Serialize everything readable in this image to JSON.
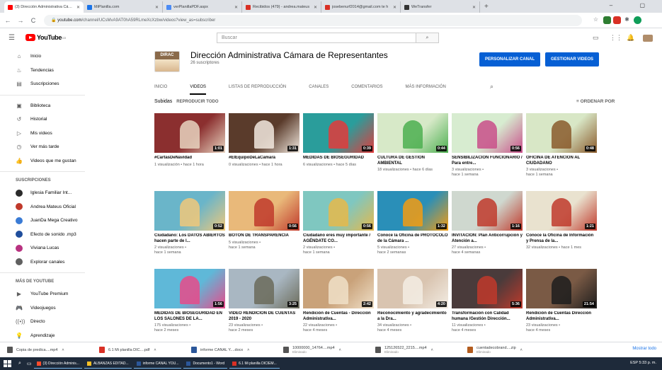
{
  "browser": {
    "tabs": [
      {
        "title": "(3) Dirección Administrativa Cám...",
        "color": "#ff0000",
        "active": true
      },
      {
        "title": "MiPlanilla.com",
        "color": "#1a73e8",
        "active": false
      },
      {
        "title": "verPlanillaPDF.aspx",
        "color": "#4b8bf5",
        "active": false
      },
      {
        "title": "Recibidos (479) - andrea.mateus",
        "color": "#d93025",
        "active": false
      },
      {
        "title": "josebenurf2014@gmail.com te h",
        "color": "#d93025",
        "active": false
      },
      {
        "title": "WeTransfer",
        "color": "#333333",
        "active": false
      }
    ],
    "url_domain": "youtube.com",
    "url_path": "/channel/UCsMvA9AT0hA59RLmeXcXzbw/videos?view_as=subscriber"
  },
  "masthead": {
    "logo_text": "YouTube",
    "logo_country": "CO",
    "search_placeholder": "Buscar"
  },
  "sidebar": {
    "main": [
      {
        "label": "Inicio",
        "icon": "home-icon",
        "glyph": "⌂"
      },
      {
        "label": "Tendencias",
        "icon": "trending-icon",
        "glyph": "♨"
      },
      {
        "label": "Suscripciones",
        "icon": "subscriptions-icon",
        "glyph": "▤"
      }
    ],
    "library": [
      {
        "label": "Biblioteca",
        "icon": "library-icon",
        "glyph": "▣"
      },
      {
        "label": "Historial",
        "icon": "history-icon",
        "glyph": "↺"
      },
      {
        "label": "Mis videos",
        "icon": "my-videos-icon",
        "glyph": "▷"
      },
      {
        "label": "Ver más tarde",
        "icon": "watch-later-icon",
        "glyph": "◷"
      },
      {
        "label": "Videos que me gustan",
        "icon": "liked-icon",
        "glyph": "👍"
      }
    ],
    "subs_heading": "SUSCRIPCIONES",
    "subs": [
      {
        "label": "Iglesia Familiar Int...",
        "color": "#2b2b2b"
      },
      {
        "label": "Andrea Mateus Oficial",
        "color": "#c0392b"
      },
      {
        "label": "JuanDa Mega Creativo",
        "color": "#3a7bd5"
      },
      {
        "label": "Efecto de sonido .mp3",
        "color": "#1f4e9c"
      },
      {
        "label": "Viviana Lucas",
        "color": "#b83280"
      },
      {
        "label": "Explorar canales",
        "color": "#606060"
      }
    ],
    "more_heading": "MÁS DE YOUTUBE",
    "more": [
      {
        "label": "YouTube Premium",
        "icon": "youtube-premium-icon",
        "glyph": "▶"
      },
      {
        "label": "Videojuegos",
        "icon": "gaming-icon",
        "glyph": "🎮"
      },
      {
        "label": "Directo",
        "icon": "live-icon",
        "glyph": "((•))"
      },
      {
        "label": "Aprendizaje",
        "icon": "learning-icon",
        "glyph": "💡"
      }
    ]
  },
  "channel": {
    "avatar_text": "DIRAC",
    "name": "Dirección Administrativa Cámara de Representantes",
    "subscribers": "26 suscriptores",
    "customize_label": "PERSONALIZAR CANAL",
    "manage_label": "GESTIONAR VIDEOS",
    "tabs": [
      "INICIO",
      "VIDEOS",
      "LISTAS DE REPRODUCCIÓN",
      "CANALES",
      "COMENTARIOS",
      "MÁS INFORMACIÓN"
    ],
    "active_tab": "VIDEOS",
    "shelf_title": "Subidas",
    "play_all": "REPRODUCIR TODO",
    "sort_label": "ORDENAR POR"
  },
  "videos": [
    {
      "title": "#CartasDeNavidad",
      "meta1": "1 visualización • hace 1 hora",
      "meta2": "",
      "dur": "1:01",
      "bg": "#8b2f2f",
      "fg": "#e8d4c0"
    },
    {
      "title": "#ElEquipoDeLaCamara",
      "meta1": "0 visualizaciones • hace 1 hora",
      "meta2": "",
      "dur": "1:31",
      "bg": "#5a3b2b",
      "fg": "#f2e9df"
    },
    {
      "title": "MEDIDAS DE BIOSEGURIDAD",
      "meta1": "6 visualizaciones • hace 5 días",
      "meta2": "",
      "dur": "0:39",
      "bg": "#2a9d9b",
      "fg": "#e23b3b"
    },
    {
      "title": "CULTURA DE GESTION AMBIENTAL",
      "meta1": "18 visualizaciones • hace 6 días",
      "meta2": "",
      "dur": "0:44",
      "bg": "#d7e9c8",
      "fg": "#4caf50"
    },
    {
      "title": "SENSIBILIZACIÓN FUNCIONARIO / Para entre...",
      "meta1": "3 visualizaciones •",
      "meta2": "hace 1 semana",
      "dur": "0:56",
      "bg": "#d7ecd0",
      "fg": "#c94f8a"
    },
    {
      "title": "OFICINA DE ATENCIÓN AL CIUDADANO",
      "meta1": "3 visualizaciones •",
      "meta2": "hace 1 semana",
      "dur": "0:48",
      "bg": "#d8e7c6",
      "fg": "#8a5a2b"
    },
    {
      "title": "Ciudadano: Los DATOS ABIERTOS hacen parte de l...",
      "meta1": "2 visualizaciones •",
      "meta2": "hace 1 semana",
      "dur": "0:52",
      "bg": "#6ab5c9",
      "fg": "#f0c87a"
    },
    {
      "title": "BOTON DE TRANSPARENCIA",
      "meta1": "5 visualizaciones •",
      "meta2": "hace 1 semana",
      "dur": "0:56",
      "bg": "#e9b97a",
      "fg": "#c0392b"
    },
    {
      "title": "Ciudadano eres muy importante / AGÉNDATE CO...",
      "meta1": "2 visualizaciones •",
      "meta2": "hace 1 semana",
      "dur": "0:56",
      "bg": "#7fc7c0",
      "fg": "#e6b84a"
    },
    {
      "title": "Conoce la Oficina de PROTOCOLO de la Cámara ...",
      "meta1": "5 visualizaciones •",
      "meta2": "hace 2 semanas",
      "dur": "1:32",
      "bg": "#2a8fb8",
      "fg": "#f39c12"
    },
    {
      "title": "INVITACIÓN: Plan Anticorrupción y Atención a...",
      "meta1": "27 visualizaciones •",
      "meta2": "hace 4 semanas",
      "dur": "1:16",
      "bg": "#cfd8cf",
      "fg": "#c0392b"
    },
    {
      "title": "Conoce la Oficina de Información y Prensa de la...",
      "meta1": "32 visualizaciones • hace 1 mes",
      "meta2": "",
      "dur": "1:21",
      "bg": "#e9e2cf",
      "fg": "#c0392b"
    },
    {
      "title": "MEDIDAS DE BIOSEGURIDAD EN LOS SALONES DE LA...",
      "meta1": "175 visualizaciones •",
      "meta2": "hace 2 meses",
      "dur": "1:56",
      "bg": "#5fb8d8",
      "fg": "#e84a8a"
    },
    {
      "title": "VIDEO RENDICION DE CUENTAS 2019 - 2020",
      "meta1": "23 visualizaciones •",
      "meta2": "hace 2 meses",
      "dur": "3:25",
      "bg": "#a9b7c2",
      "fg": "#6b6b5a"
    },
    {
      "title": "Rendición de Cuentas - Dirección Administrativa...",
      "meta1": "22 visualizaciones •",
      "meta2": "hace 4 meses",
      "dur": "2:42",
      "bg": "#c9a27a",
      "fg": "#f0e0c8"
    },
    {
      "title": "Reconocimiento y agradecimiento a la Dra...",
      "meta1": "34 visualizaciones •",
      "meta2": "hace 4 meses",
      "dur": "4:20",
      "bg": "#d9c4b0",
      "fg": "#f3ede4"
    },
    {
      "title": "Transformación con Calidad humana /Gestión Dirección...",
      "meta1": "11 visualizaciones •",
      "meta2": "hace 4 meses",
      "dur": "5:36",
      "bg": "#4a3b3b",
      "fg": "#c0392b"
    },
    {
      "title": "Rendición de Cuentas Dirección Administrativa...",
      "meta1": "23 visualizaciones •",
      "meta2": "hace 4 meses",
      "dur": "21:54",
      "bg": "#7a5a45",
      "fg": "#1d1d1d"
    }
  ],
  "downloads": [
    {
      "name": "Copia de predica....mp4",
      "sub": "",
      "color": "#555555"
    },
    {
      "name": "6.1 Mi planilla DIC....pdf",
      "sub": "",
      "color": "#d93025"
    },
    {
      "name": "informe CANAL Y....docx",
      "sub": "",
      "color": "#2b579a"
    },
    {
      "name": "10000000_14764....mp4",
      "sub": "Eliminado",
      "color": "#555555"
    },
    {
      "name": "125126522_2215....mp4",
      "sub": "Eliminado",
      "color": "#555555"
    },
    {
      "name": "cuentadecobrand....zip",
      "sub": "Eliminado",
      "color": "#b35c1e"
    }
  ],
  "downloads_show_all": "Mostrar todo",
  "taskbar": {
    "apps": [
      {
        "label": "(3) Dirección Adminis...",
        "color": "#ff4b2b"
      },
      {
        "label": "ALBANZAS EDITAD...",
        "color": "#f6c026"
      },
      {
        "label": "informe CANAL YOU...",
        "color": "#2b579a"
      },
      {
        "label": "Documento1 - Word",
        "color": "#2b579a"
      },
      {
        "label": "6.1 Mi planilla DICIEM...",
        "color": "#d93025"
      }
    ],
    "clock": "ESP  5:33 p. m."
  }
}
